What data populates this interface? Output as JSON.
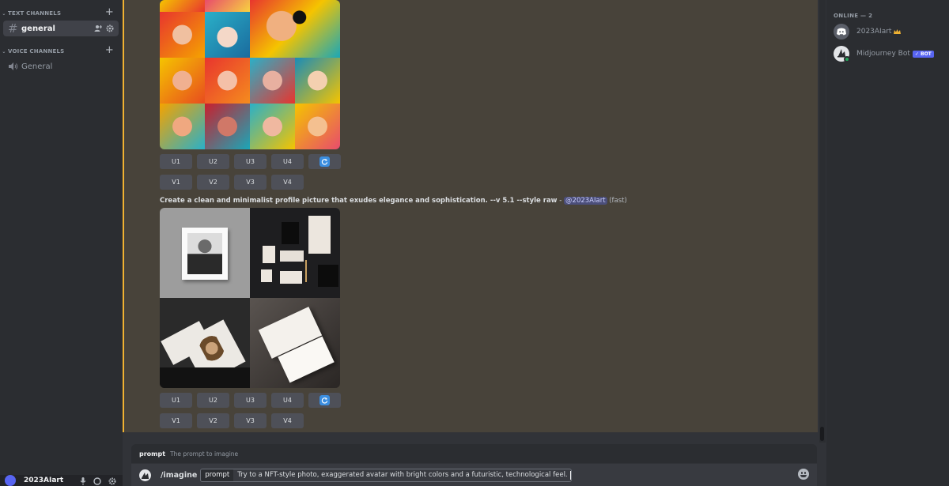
{
  "sidebar": {
    "text_category": "TEXT CHANNELS",
    "voice_category": "VOICE CHANNELS",
    "text_channel": "general",
    "voice_channel": "General"
  },
  "user": {
    "name": "2023AIart"
  },
  "message_upper": {
    "buttons_row1": [
      "U1",
      "U2",
      "U3",
      "U4"
    ],
    "buttons_row2": [
      "V1",
      "V2",
      "V3",
      "V4"
    ]
  },
  "message_lower": {
    "prompt_text": "Create a clean and minimalist profile picture that exudes elegance and sophistication. --v 5.1 --style raw",
    "separator": " - ",
    "mention": "@2023AIart",
    "speed": "(fast)",
    "buttons_row1": [
      "U1",
      "U2",
      "U3",
      "U4"
    ],
    "buttons_row2": [
      "V1",
      "V2",
      "V3",
      "V4"
    ]
  },
  "composer": {
    "hint_name": "prompt",
    "hint_desc": "The prompt to imagine",
    "command": "/imagine",
    "param_name": "prompt",
    "param_value": "Try to a NFT-style photo, exaggerated avatar with bright colors and a futuristic, technological feel."
  },
  "members": {
    "header": "ONLINE — 2",
    "list": [
      {
        "name": "2023AIart",
        "icon": "crown-icon"
      },
      {
        "name": "Midjourney Bot",
        "badge": "✓ BOT"
      }
    ]
  },
  "colors": {
    "accent": "#5865f2",
    "highlight_bar": "#f0b232",
    "online": "#23a559"
  }
}
